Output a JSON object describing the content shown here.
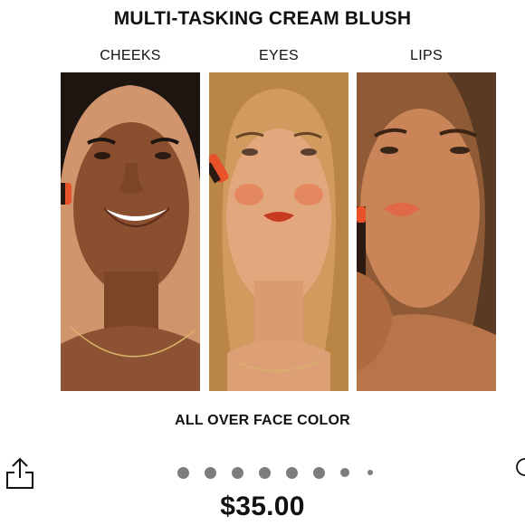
{
  "promo": {
    "title": "MULTI-TASKING CREAM BLUSH",
    "panels": [
      {
        "label": "CHEEKS"
      },
      {
        "label": "EYES"
      },
      {
        "label": "LIPS"
      }
    ],
    "subtitle": "ALL OVER FACE COLOR"
  },
  "carousel": {
    "dot_count": 8,
    "active_index": null
  },
  "product": {
    "price": "$35.00"
  },
  "icons": {
    "share": "share-icon",
    "edge": "like-icon"
  },
  "colors": {
    "dot": "#7c7c7c",
    "text": "#111111",
    "blush_accent": "#e8512a"
  }
}
